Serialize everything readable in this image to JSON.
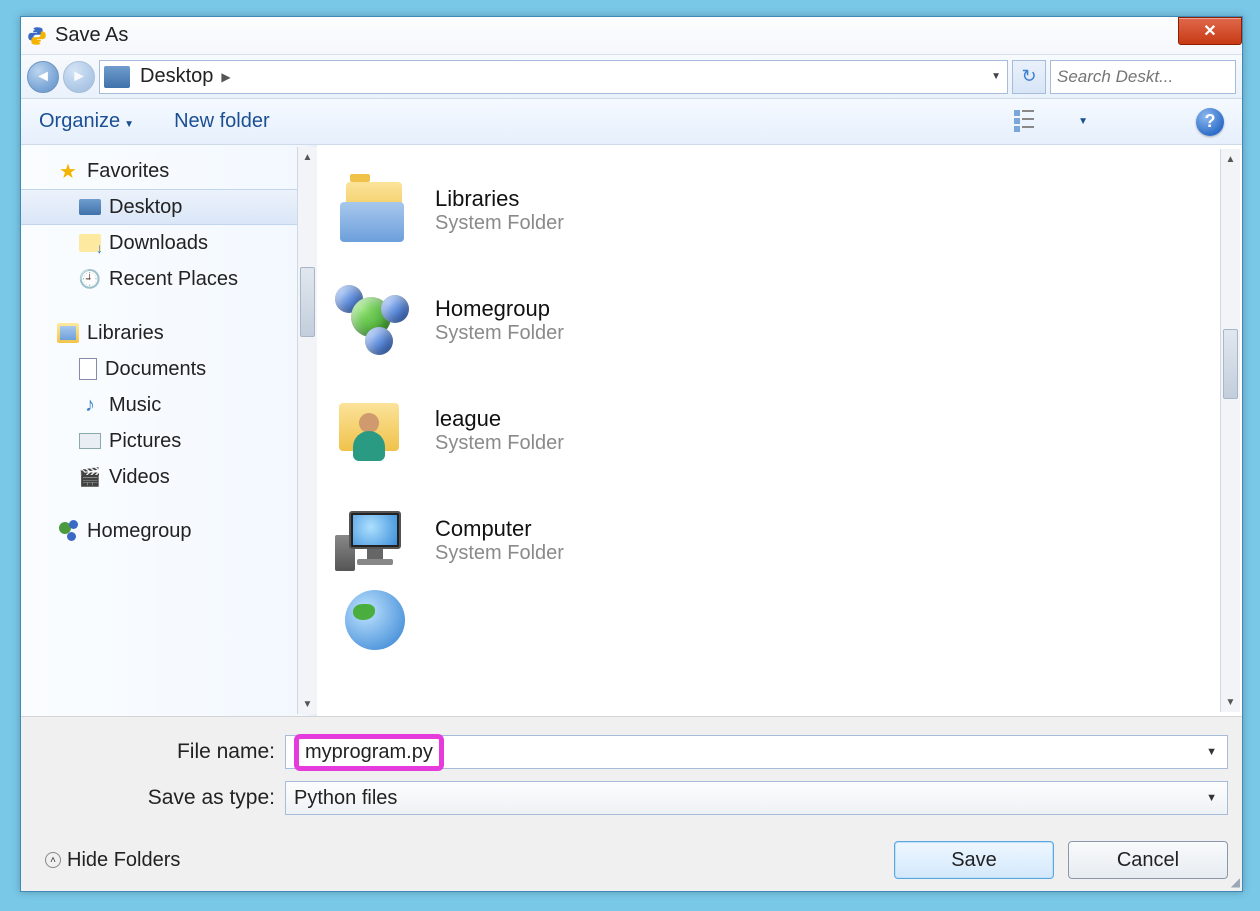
{
  "titlebar": {
    "title": "Save As"
  },
  "nav": {
    "location": "Desktop",
    "search_placeholder": "Search Deskt..."
  },
  "toolbar": {
    "organize": "Organize",
    "new_folder": "New folder"
  },
  "sidebar": {
    "favorites_label": "Favorites",
    "favorites": [
      {
        "label": "Desktop",
        "icon": "monitor",
        "selected": true
      },
      {
        "label": "Downloads",
        "icon": "dl"
      },
      {
        "label": "Recent Places",
        "icon": "recent"
      }
    ],
    "libraries_label": "Libraries",
    "libraries": [
      {
        "label": "Documents",
        "icon": "doc"
      },
      {
        "label": "Music",
        "icon": "music"
      },
      {
        "label": "Pictures",
        "icon": "pic"
      },
      {
        "label": "Videos",
        "icon": "vid"
      }
    ],
    "homegroup_label": "Homegroup"
  },
  "main_items": [
    {
      "name": "Libraries",
      "type": "System Folder",
      "icon": "libraries"
    },
    {
      "name": "Homegroup",
      "type": "System Folder",
      "icon": "homegroup"
    },
    {
      "name": "league",
      "type": "System Folder",
      "icon": "user"
    },
    {
      "name": "Computer",
      "type": "System Folder",
      "icon": "computer"
    }
  ],
  "form": {
    "filename_label": "File name:",
    "filename_value": "myprogram.py",
    "savetype_label": "Save as type:",
    "savetype_value": "Python files",
    "hide_folders": "Hide Folders",
    "save": "Save",
    "cancel": "Cancel"
  }
}
